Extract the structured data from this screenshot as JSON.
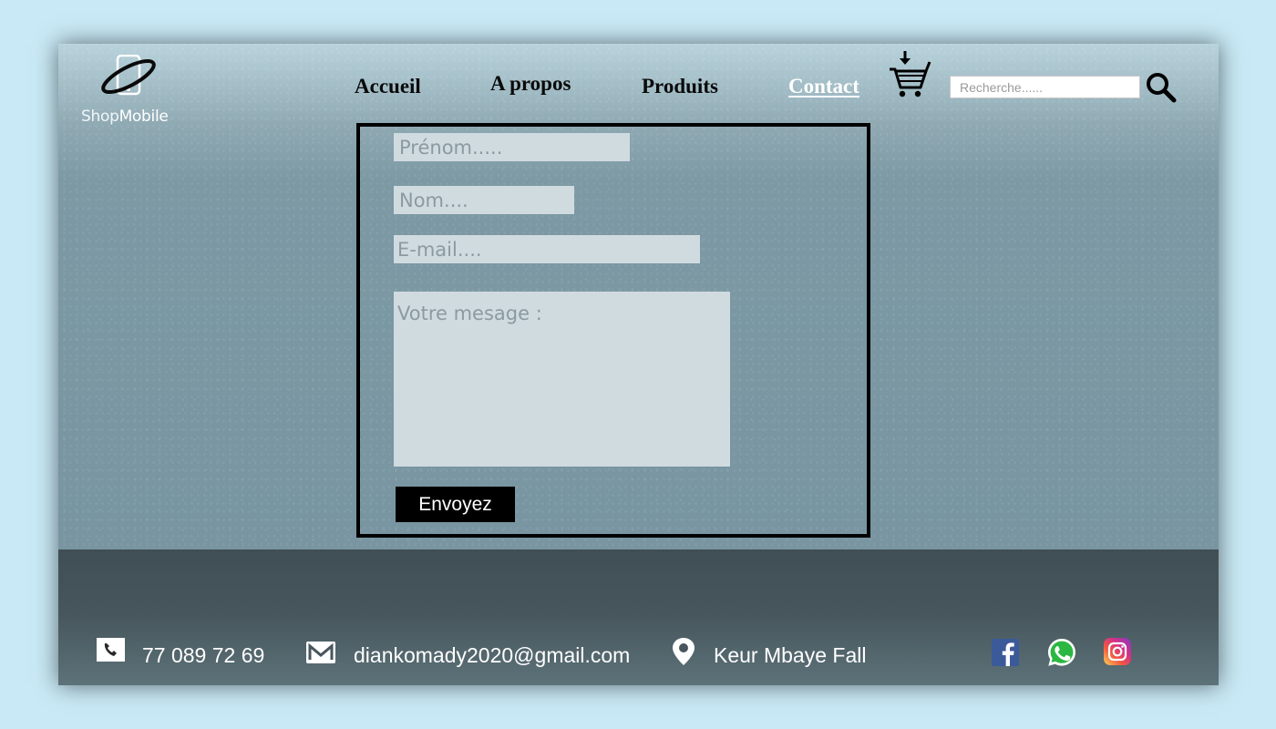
{
  "brand": {
    "shop": "Shop",
    "mobile": "Mobile"
  },
  "nav": {
    "items": [
      {
        "label": "Accueil"
      },
      {
        "label": "A propos"
      },
      {
        "label": "Produits"
      },
      {
        "label": "Contact"
      }
    ],
    "active": "Contact"
  },
  "search": {
    "placeholder": "Recherche......",
    "value": ""
  },
  "form": {
    "prenom_placeholder": "Prénom.....",
    "nom_placeholder": "Nom....",
    "email_placeholder": "E-mail....",
    "message_placeholder": "Votre mesage :",
    "submit_label": "Envoyez"
  },
  "footer": {
    "phone": "77 089 72 69",
    "email": "diankomady2020@gmail.com",
    "address": "Keur Mbaye Fall",
    "social": [
      "facebook-icon",
      "whatsapp-icon",
      "instagram-icon"
    ]
  },
  "colors": {
    "page_bg": "#c8e9f5",
    "content_bg": "#7895a1",
    "footer_bg": "#404f55",
    "button_bg": "#000000",
    "field_bg": "#d0dbe0"
  }
}
